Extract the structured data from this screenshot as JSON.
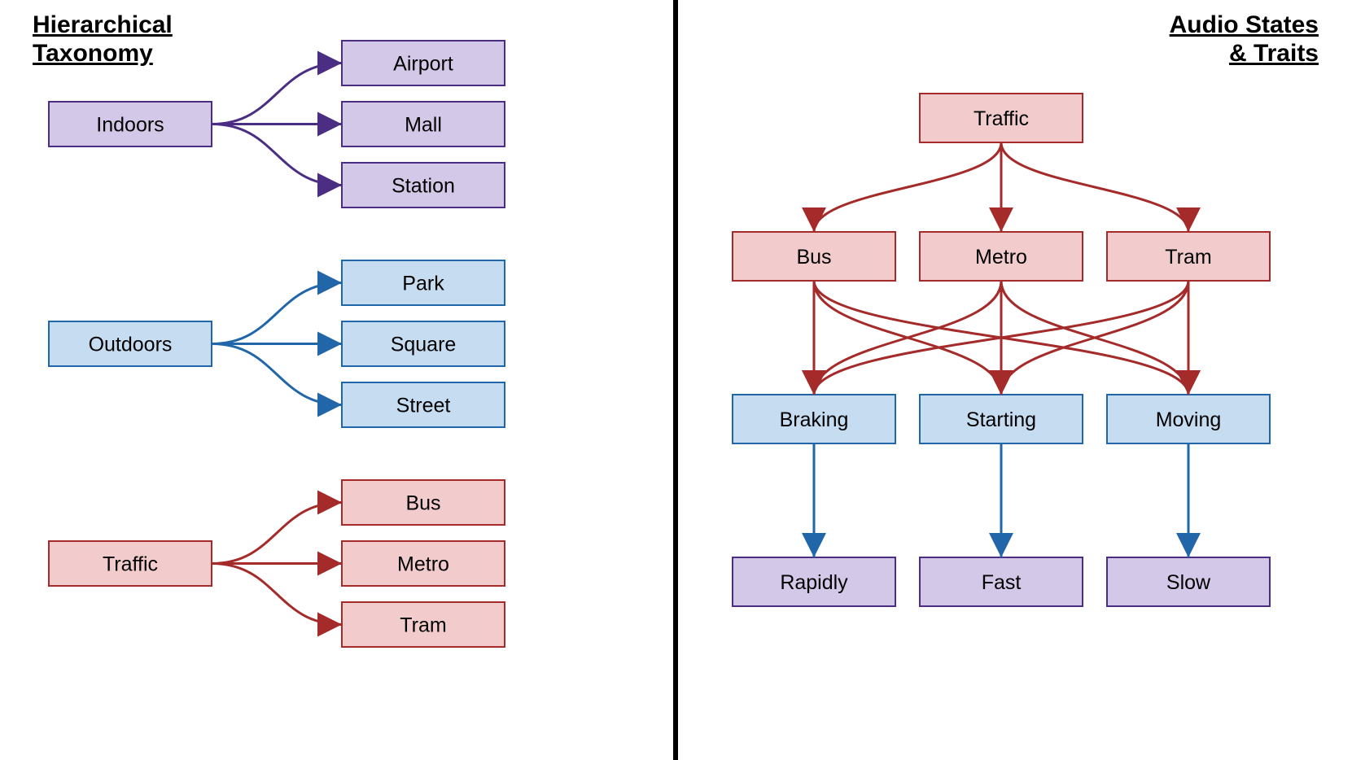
{
  "left": {
    "title1": "Hierarchical",
    "title2": "Taxonomy",
    "groups": [
      {
        "parent": "Indoors",
        "children": [
          "Airport",
          "Mall",
          "Station"
        ],
        "color": "purple"
      },
      {
        "parent": "Outdoors",
        "children": [
          "Park",
          "Square",
          "Street"
        ],
        "color": "blue"
      },
      {
        "parent": "Traffic",
        "children": [
          "Bus",
          "Metro",
          "Tram"
        ],
        "color": "red"
      }
    ]
  },
  "right": {
    "title1": "Audio States",
    "title2": "& Traits",
    "levels": [
      {
        "color": "red",
        "nodes": [
          "Traffic"
        ]
      },
      {
        "color": "red",
        "nodes": [
          "Bus",
          "Metro",
          "Tram"
        ]
      },
      {
        "color": "blue",
        "nodes": [
          "Braking",
          "Starting",
          "Moving"
        ]
      },
      {
        "color": "purple",
        "nodes": [
          "Rapidly",
          "Fast",
          "Slow"
        ]
      }
    ],
    "edges": {
      "l0_l1": "one-to-all",
      "l1_l2": "all-to-all",
      "l2_l3": "one-to-one"
    }
  }
}
